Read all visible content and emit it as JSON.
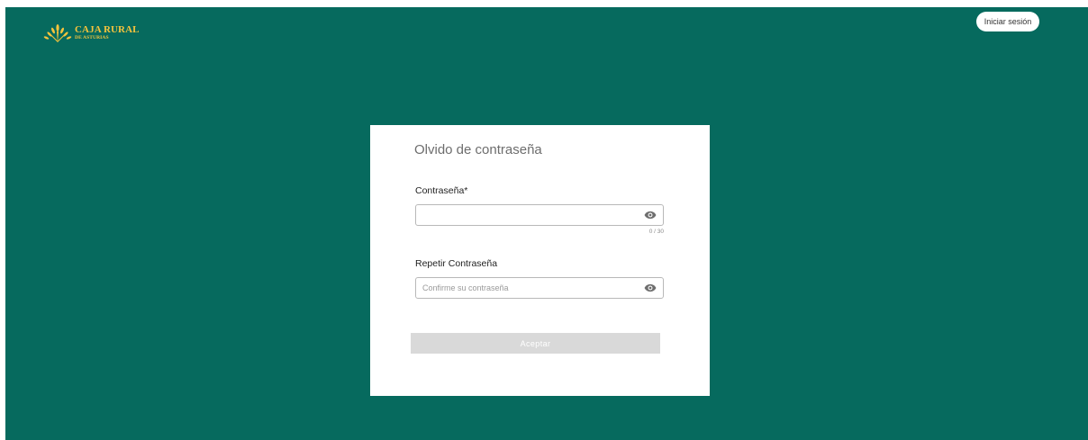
{
  "header": {
    "brand_name": "CAJA RURAL",
    "brand_sub": "DE ASTURIAS",
    "login_label": "Iniciar sesión"
  },
  "colors": {
    "background": "#066a5e",
    "brand_gold": "#f6c43c",
    "button_disabled": "#d9d9d9"
  },
  "form": {
    "title": "Olvido de contraseña",
    "password": {
      "label": "Contraseña*",
      "value": "",
      "placeholder": "",
      "counter": "0 / 30",
      "icon": "eye-icon"
    },
    "repeat_password": {
      "label": "Repetir Contraseña",
      "value": "",
      "placeholder": "Confirme su contraseña",
      "icon": "eye-icon"
    },
    "submit_label": "Aceptar",
    "submit_disabled": true
  }
}
